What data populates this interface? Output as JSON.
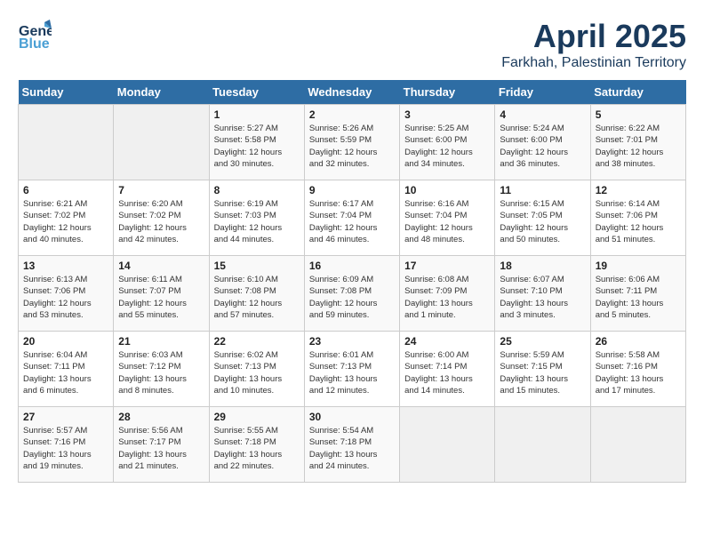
{
  "header": {
    "logo_general": "General",
    "logo_blue": "Blue",
    "month": "April 2025",
    "location": "Farkhah, Palestinian Territory"
  },
  "weekdays": [
    "Sunday",
    "Monday",
    "Tuesday",
    "Wednesday",
    "Thursday",
    "Friday",
    "Saturday"
  ],
  "weeks": [
    [
      {
        "day": "",
        "info": ""
      },
      {
        "day": "",
        "info": ""
      },
      {
        "day": "1",
        "info": "Sunrise: 5:27 AM\nSunset: 5:58 PM\nDaylight: 12 hours\nand 30 minutes."
      },
      {
        "day": "2",
        "info": "Sunrise: 5:26 AM\nSunset: 5:59 PM\nDaylight: 12 hours\nand 32 minutes."
      },
      {
        "day": "3",
        "info": "Sunrise: 5:25 AM\nSunset: 6:00 PM\nDaylight: 12 hours\nand 34 minutes."
      },
      {
        "day": "4",
        "info": "Sunrise: 5:24 AM\nSunset: 6:00 PM\nDaylight: 12 hours\nand 36 minutes."
      },
      {
        "day": "5",
        "info": "Sunrise: 6:22 AM\nSunset: 7:01 PM\nDaylight: 12 hours\nand 38 minutes."
      }
    ],
    [
      {
        "day": "6",
        "info": "Sunrise: 6:21 AM\nSunset: 7:02 PM\nDaylight: 12 hours\nand 40 minutes."
      },
      {
        "day": "7",
        "info": "Sunrise: 6:20 AM\nSunset: 7:02 PM\nDaylight: 12 hours\nand 42 minutes."
      },
      {
        "day": "8",
        "info": "Sunrise: 6:19 AM\nSunset: 7:03 PM\nDaylight: 12 hours\nand 44 minutes."
      },
      {
        "day": "9",
        "info": "Sunrise: 6:17 AM\nSunset: 7:04 PM\nDaylight: 12 hours\nand 46 minutes."
      },
      {
        "day": "10",
        "info": "Sunrise: 6:16 AM\nSunset: 7:04 PM\nDaylight: 12 hours\nand 48 minutes."
      },
      {
        "day": "11",
        "info": "Sunrise: 6:15 AM\nSunset: 7:05 PM\nDaylight: 12 hours\nand 50 minutes."
      },
      {
        "day": "12",
        "info": "Sunrise: 6:14 AM\nSunset: 7:06 PM\nDaylight: 12 hours\nand 51 minutes."
      }
    ],
    [
      {
        "day": "13",
        "info": "Sunrise: 6:13 AM\nSunset: 7:06 PM\nDaylight: 12 hours\nand 53 minutes."
      },
      {
        "day": "14",
        "info": "Sunrise: 6:11 AM\nSunset: 7:07 PM\nDaylight: 12 hours\nand 55 minutes."
      },
      {
        "day": "15",
        "info": "Sunrise: 6:10 AM\nSunset: 7:08 PM\nDaylight: 12 hours\nand 57 minutes."
      },
      {
        "day": "16",
        "info": "Sunrise: 6:09 AM\nSunset: 7:08 PM\nDaylight: 12 hours\nand 59 minutes."
      },
      {
        "day": "17",
        "info": "Sunrise: 6:08 AM\nSunset: 7:09 PM\nDaylight: 13 hours\nand 1 minute."
      },
      {
        "day": "18",
        "info": "Sunrise: 6:07 AM\nSunset: 7:10 PM\nDaylight: 13 hours\nand 3 minutes."
      },
      {
        "day": "19",
        "info": "Sunrise: 6:06 AM\nSunset: 7:11 PM\nDaylight: 13 hours\nand 5 minutes."
      }
    ],
    [
      {
        "day": "20",
        "info": "Sunrise: 6:04 AM\nSunset: 7:11 PM\nDaylight: 13 hours\nand 6 minutes."
      },
      {
        "day": "21",
        "info": "Sunrise: 6:03 AM\nSunset: 7:12 PM\nDaylight: 13 hours\nand 8 minutes."
      },
      {
        "day": "22",
        "info": "Sunrise: 6:02 AM\nSunset: 7:13 PM\nDaylight: 13 hours\nand 10 minutes."
      },
      {
        "day": "23",
        "info": "Sunrise: 6:01 AM\nSunset: 7:13 PM\nDaylight: 13 hours\nand 12 minutes."
      },
      {
        "day": "24",
        "info": "Sunrise: 6:00 AM\nSunset: 7:14 PM\nDaylight: 13 hours\nand 14 minutes."
      },
      {
        "day": "25",
        "info": "Sunrise: 5:59 AM\nSunset: 7:15 PM\nDaylight: 13 hours\nand 15 minutes."
      },
      {
        "day": "26",
        "info": "Sunrise: 5:58 AM\nSunset: 7:16 PM\nDaylight: 13 hours\nand 17 minutes."
      }
    ],
    [
      {
        "day": "27",
        "info": "Sunrise: 5:57 AM\nSunset: 7:16 PM\nDaylight: 13 hours\nand 19 minutes."
      },
      {
        "day": "28",
        "info": "Sunrise: 5:56 AM\nSunset: 7:17 PM\nDaylight: 13 hours\nand 21 minutes."
      },
      {
        "day": "29",
        "info": "Sunrise: 5:55 AM\nSunset: 7:18 PM\nDaylight: 13 hours\nand 22 minutes."
      },
      {
        "day": "30",
        "info": "Sunrise: 5:54 AM\nSunset: 7:18 PM\nDaylight: 13 hours\nand 24 minutes."
      },
      {
        "day": "",
        "info": ""
      },
      {
        "day": "",
        "info": ""
      },
      {
        "day": "",
        "info": ""
      }
    ]
  ]
}
